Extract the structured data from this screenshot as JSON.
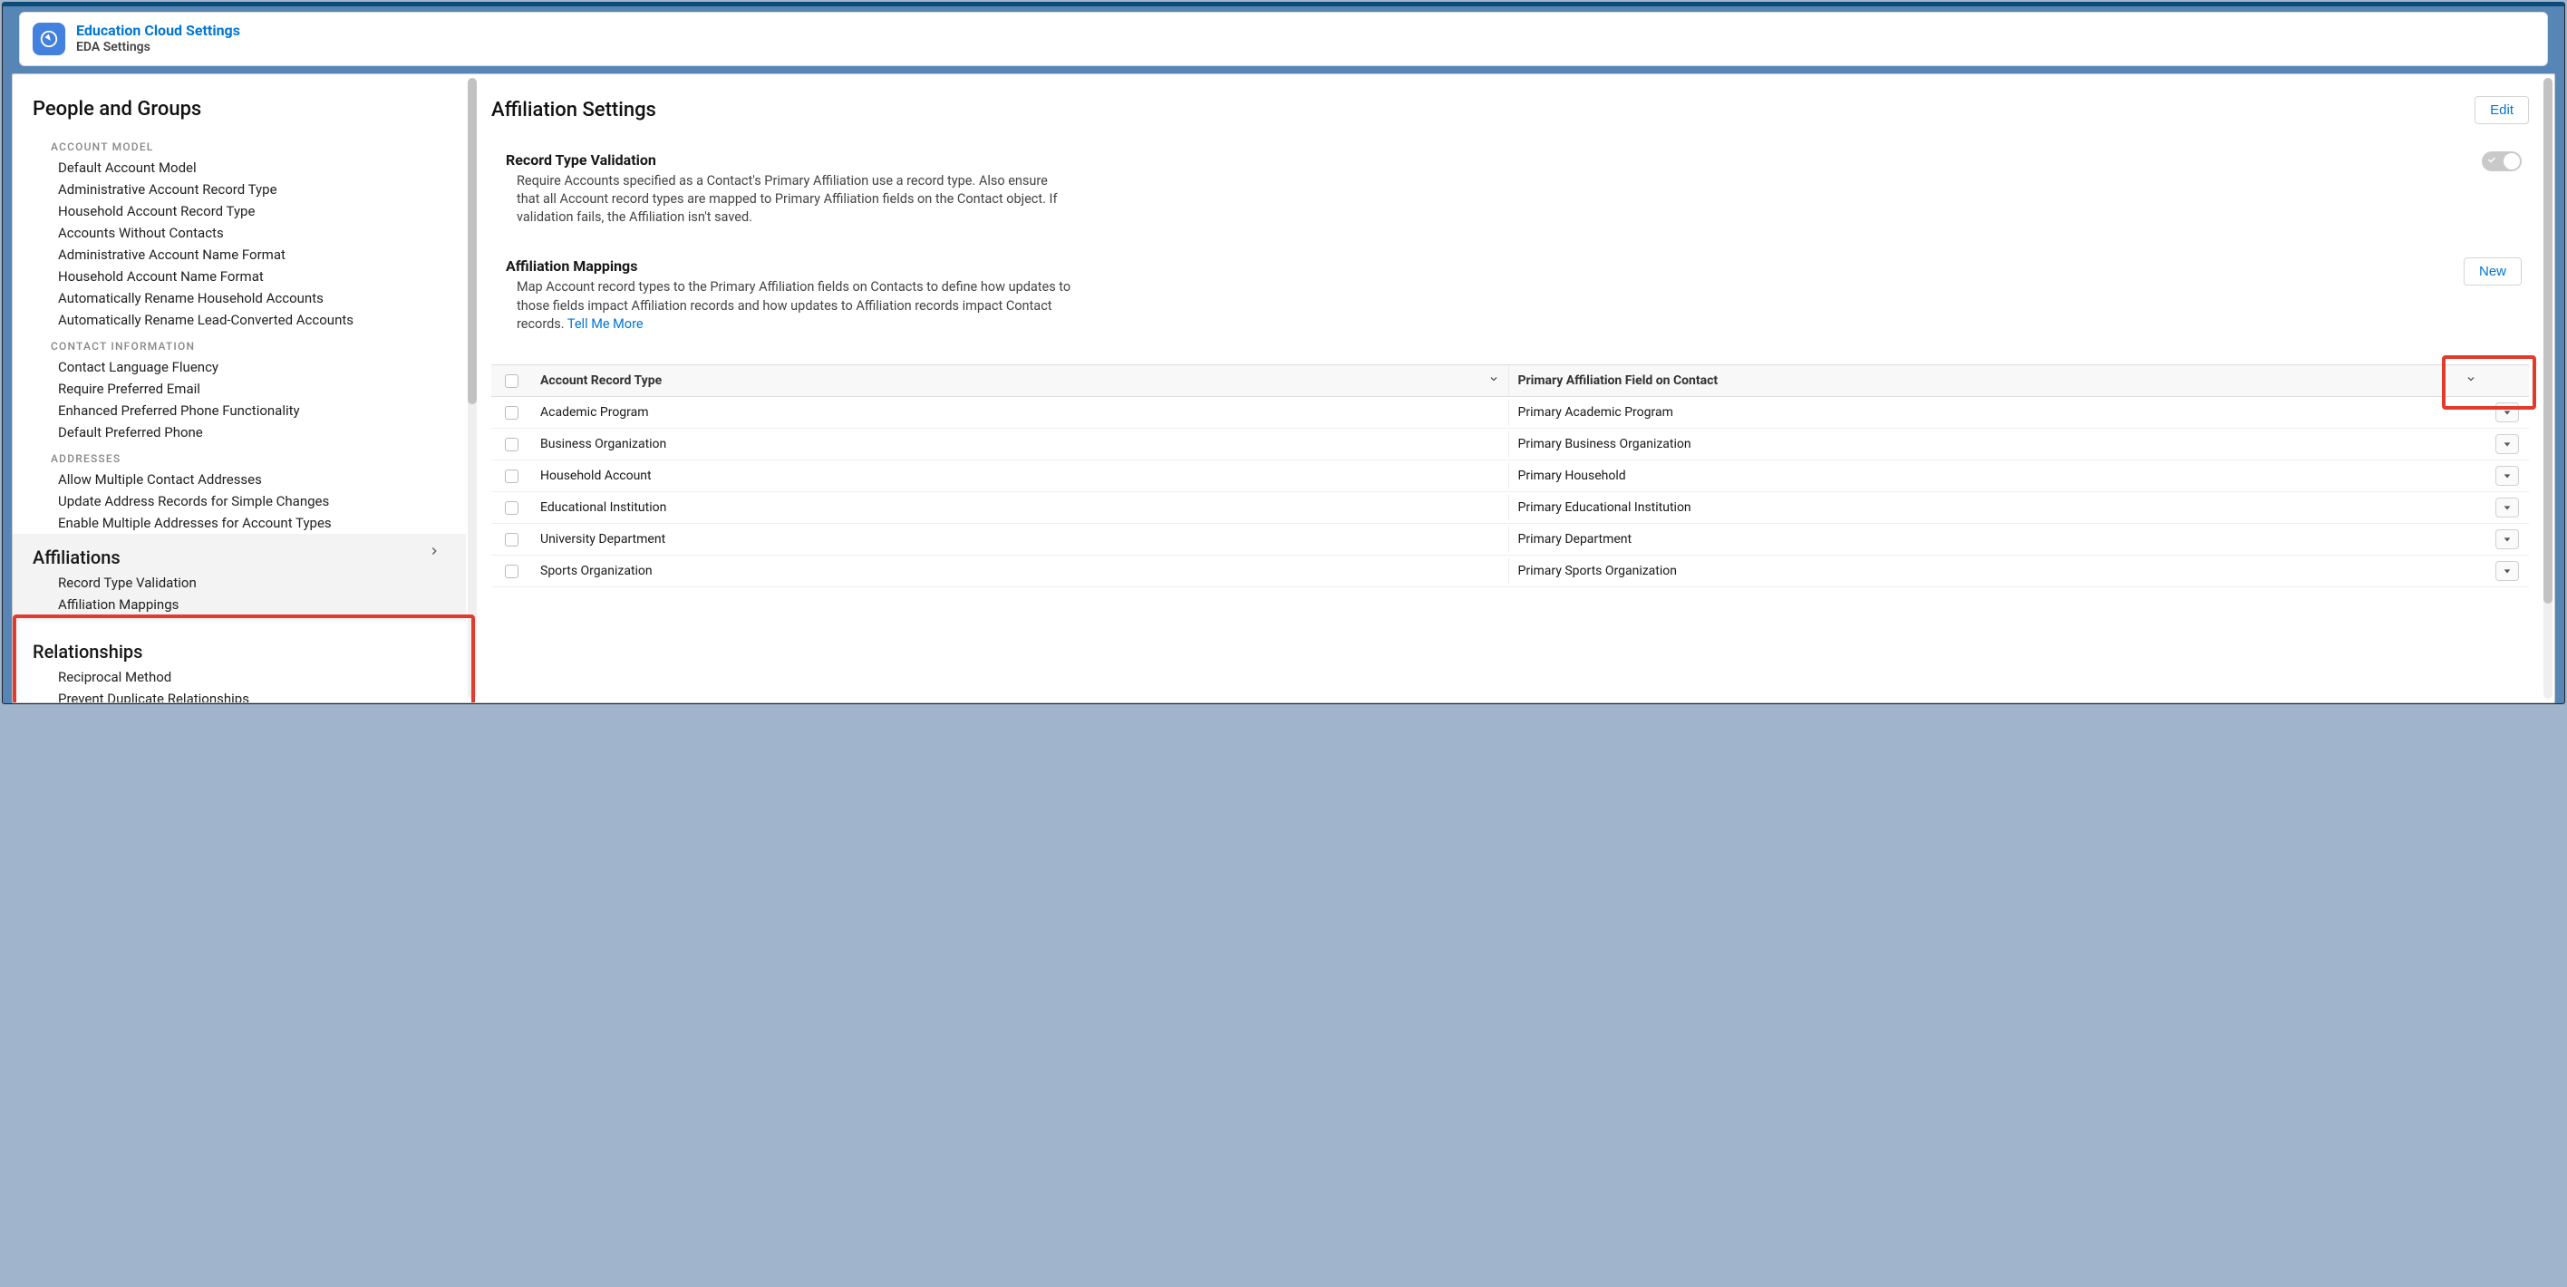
{
  "header": {
    "title": "Education Cloud Settings",
    "subtitle": "EDA Settings"
  },
  "sidebar": {
    "group1_title": "People and Groups",
    "cat_account_model": "ACCOUNT MODEL",
    "account_model_items": [
      "Default Account Model",
      "Administrative Account Record Type",
      "Household Account Record Type",
      "Accounts Without Contacts",
      "Administrative Account Name Format",
      "Household Account Name Format",
      "Automatically Rename Household Accounts",
      "Automatically Rename Lead-Converted Accounts"
    ],
    "cat_contact_info": "CONTACT INFORMATION",
    "contact_info_items": [
      "Contact Language Fluency",
      "Require Preferred Email",
      "Enhanced Preferred Phone Functionality",
      "Default Preferred Phone"
    ],
    "cat_addresses": "ADDRESSES",
    "addresses_items": [
      "Allow Multiple Contact Addresses",
      "Update Address Records for Simple Changes",
      "Enable Multiple Addresses for Account Types"
    ],
    "group2_title": "Affiliations",
    "affiliations_items": [
      "Record Type Validation",
      "Affiliation Mappings"
    ],
    "group3_title": "Relationships",
    "relationships_items": [
      "Reciprocal Method",
      "Prevent Duplicate Relationships"
    ]
  },
  "main": {
    "title": "Affiliation Settings",
    "edit_label": "Edit",
    "record_type_validation": {
      "label": "Record Type Validation",
      "desc": "Require Accounts specified as a Contact's Primary Affiliation use a record type. Also ensure that all Account record types are mapped to Primary Affiliation fields on the Contact object. If validation fails, the Affiliation isn't saved.",
      "enabled": false
    },
    "affiliation_mappings": {
      "label": "Affiliation Mappings",
      "desc": "Map Account record types to the Primary Affiliation fields on Contacts to define how updates to those fields impact Affiliation records and how updates to Affiliation records impact Contact records. ",
      "link": "Tell Me More",
      "new_label": "New"
    },
    "table": {
      "col1": "Account Record Type",
      "col2": "Primary Affiliation Field on Contact",
      "rows": [
        {
          "c1": "Academic Program",
          "c2": "Primary Academic Program"
        },
        {
          "c1": "Business Organization",
          "c2": "Primary Business Organization"
        },
        {
          "c1": "Household Account",
          "c2": "Primary Household"
        },
        {
          "c1": "Educational Institution",
          "c2": "Primary Educational Institution"
        },
        {
          "c1": "University Department",
          "c2": "Primary Department"
        },
        {
          "c1": "Sports Organization",
          "c2": "Primary Sports Organization"
        }
      ]
    }
  }
}
